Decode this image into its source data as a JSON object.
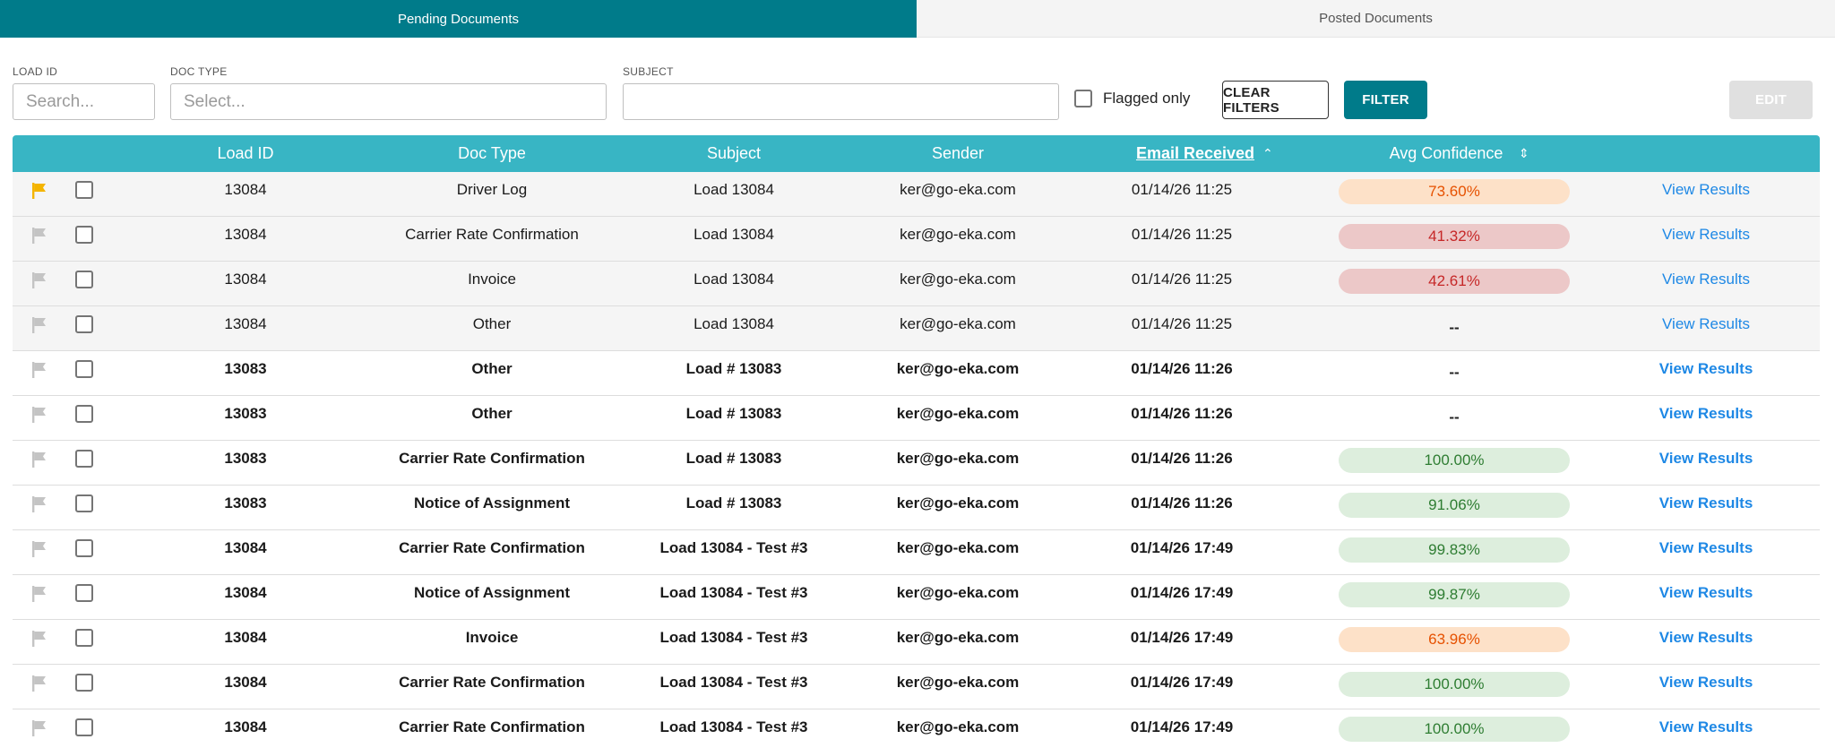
{
  "tabs": {
    "pending": "Pending Documents",
    "posted": "Posted Documents"
  },
  "filters": {
    "load_id": {
      "label": "LOAD ID",
      "placeholder": "Search..."
    },
    "doc_type": {
      "label": "DOC TYPE",
      "placeholder": "Select..."
    },
    "subject": {
      "label": "SUBJECT",
      "placeholder": ""
    },
    "flagged_only": "Flagged only",
    "clear_label": "CLEAR FILTERS",
    "filter_label": "FILTER",
    "edit_label": "EDIT"
  },
  "colors": {
    "accent": "#007b8a",
    "header": "#38b5c4",
    "flag_on": "#f4b400",
    "flag_off": "#c4c4c4",
    "link": "#1e88e5",
    "conf_high_bg": "#ddeedd",
    "conf_high_text": "#2e7d32",
    "conf_mid_bg": "#fde1c8",
    "conf_mid_text": "#e65100",
    "conf_low_bg": "#ecc8c8",
    "conf_low_text": "#c62828"
  },
  "table": {
    "headers": {
      "load_id": "Load ID",
      "doc_type": "Doc Type",
      "subject": "Subject",
      "sender": "Sender",
      "email_received": "Email Received",
      "avg_confidence": "Avg Confidence",
      "sort_asc_icon": "⌃",
      "sort_both_icon": "⇕"
    },
    "action_label": "View Results",
    "rows": [
      {
        "flagged": true,
        "load_id": "13084",
        "doc_type": "Driver Log",
        "subject": "Load 13084",
        "sender": "ker@go-eka.com",
        "received": "01/14/26 11:25",
        "confidence": "73.60%",
        "level": "mid",
        "bold": false
      },
      {
        "flagged": false,
        "load_id": "13084",
        "doc_type": "Carrier Rate Confirmation",
        "subject": "Load 13084",
        "sender": "ker@go-eka.com",
        "received": "01/14/26 11:25",
        "confidence": "41.32%",
        "level": "low",
        "bold": false
      },
      {
        "flagged": false,
        "load_id": "13084",
        "doc_type": "Invoice",
        "subject": "Load 13084",
        "sender": "ker@go-eka.com",
        "received": "01/14/26 11:25",
        "confidence": "42.61%",
        "level": "low",
        "bold": false
      },
      {
        "flagged": false,
        "load_id": "13084",
        "doc_type": "Other",
        "subject": "Load 13084",
        "sender": "ker@go-eka.com",
        "received": "01/14/26 11:25",
        "confidence": "--",
        "level": "none",
        "bold": false
      },
      {
        "flagged": false,
        "load_id": "13083",
        "doc_type": "Other",
        "subject": "Load # 13083",
        "sender": "ker@go-eka.com",
        "received": "01/14/26 11:26",
        "confidence": "--",
        "level": "none",
        "bold": true
      },
      {
        "flagged": false,
        "load_id": "13083",
        "doc_type": "Other",
        "subject": "Load # 13083",
        "sender": "ker@go-eka.com",
        "received": "01/14/26 11:26",
        "confidence": "--",
        "level": "none",
        "bold": true
      },
      {
        "flagged": false,
        "load_id": "13083",
        "doc_type": "Carrier Rate Confirmation",
        "subject": "Load # 13083",
        "sender": "ker@go-eka.com",
        "received": "01/14/26 11:26",
        "confidence": "100.00%",
        "level": "high",
        "bold": true
      },
      {
        "flagged": false,
        "load_id": "13083",
        "doc_type": "Notice of Assignment",
        "subject": "Load # 13083",
        "sender": "ker@go-eka.com",
        "received": "01/14/26 11:26",
        "confidence": "91.06%",
        "level": "high",
        "bold": true
      },
      {
        "flagged": false,
        "load_id": "13084",
        "doc_type": "Carrier Rate Confirmation",
        "subject": "Load 13084 - Test #3",
        "sender": "ker@go-eka.com",
        "received": "01/14/26 17:49",
        "confidence": "99.83%",
        "level": "high",
        "bold": true
      },
      {
        "flagged": false,
        "load_id": "13084",
        "doc_type": "Notice of Assignment",
        "subject": "Load 13084 - Test #3",
        "sender": "ker@go-eka.com",
        "received": "01/14/26 17:49",
        "confidence": "99.87%",
        "level": "high",
        "bold": true
      },
      {
        "flagged": false,
        "load_id": "13084",
        "doc_type": "Invoice",
        "subject": "Load 13084 - Test #3",
        "sender": "ker@go-eka.com",
        "received": "01/14/26 17:49",
        "confidence": "63.96%",
        "level": "mid",
        "bold": true
      },
      {
        "flagged": false,
        "load_id": "13084",
        "doc_type": "Carrier Rate Confirmation",
        "subject": "Load 13084 - Test #3",
        "sender": "ker@go-eka.com",
        "received": "01/14/26 17:49",
        "confidence": "100.00%",
        "level": "high",
        "bold": true
      },
      {
        "flagged": false,
        "load_id": "13084",
        "doc_type": "Carrier Rate Confirmation",
        "subject": "Load 13084 - Test #3",
        "sender": "ker@go-eka.com",
        "received": "01/14/26 17:49",
        "confidence": "100.00%",
        "level": "high",
        "bold": true
      }
    ]
  }
}
